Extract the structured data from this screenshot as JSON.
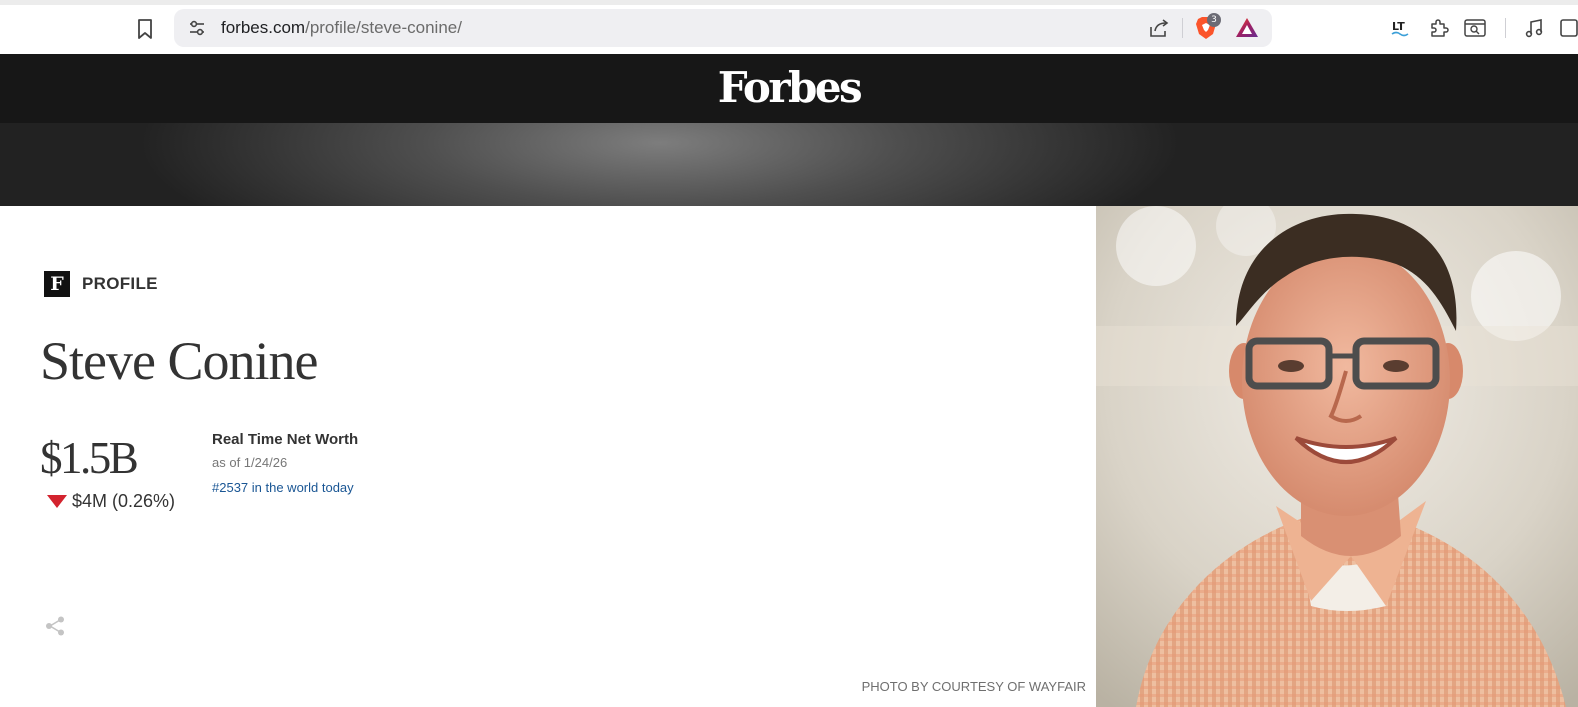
{
  "browser": {
    "url_domain": "forbes.com",
    "url_path": "/profile/steve-conine/",
    "shield_count": "3",
    "extensions": [
      "languagetool-icon",
      "puzzle-icon",
      "tab-search-icon",
      "music-icon",
      "sidebar-icon"
    ]
  },
  "header": {
    "logo": "Forbes"
  },
  "profile": {
    "tag_letter": "F",
    "tag_label": "PROFILE",
    "name": "Steve Conine",
    "net_worth": "$1.5B",
    "change": "$4M (0.26%)",
    "change_direction": "down",
    "real_time_label": "Real Time Net Worth",
    "as_of": "as of 1/24/26",
    "rank_text": "#2537 in the world today",
    "photo_credit": "PHOTO BY COURTESY OF WAYFAIR"
  },
  "colors": {
    "header_bg": "#171717",
    "down_red": "#d3232e",
    "link_blue": "#1a5694",
    "shirt": "#e0a27f"
  }
}
